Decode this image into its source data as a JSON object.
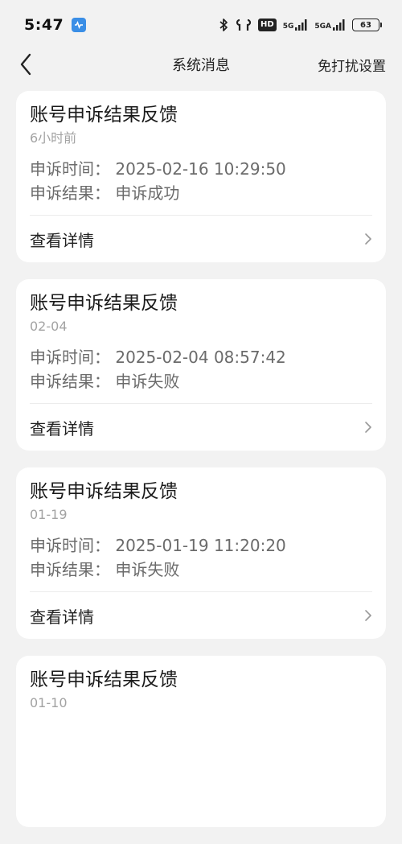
{
  "status_bar": {
    "time": "5:47",
    "network_label_1": "5G",
    "network_label_2": "5GA",
    "hd_label": "HD",
    "battery": "63"
  },
  "nav": {
    "title": "系统消息",
    "action": "免打扰设置"
  },
  "messages": [
    {
      "title": "账号申诉结果反馈",
      "time": "6小时前",
      "line1": "申诉时间：  2025-02-16 10:29:50",
      "line2": "申诉结果：  申诉成功",
      "detail": "查看详情"
    },
    {
      "title": "账号申诉结果反馈",
      "time": "02-04",
      "line1": "申诉时间：  2025-02-04 08:57:42",
      "line2": "申诉结果：  申诉失败",
      "detail": "查看详情"
    },
    {
      "title": "账号申诉结果反馈",
      "time": "01-19",
      "line1": "申诉时间：  2025-01-19 11:20:20",
      "line2": "申诉结果：  申诉失败",
      "detail": "查看详情"
    },
    {
      "title": "账号申诉结果反馈",
      "time": "01-10"
    }
  ]
}
